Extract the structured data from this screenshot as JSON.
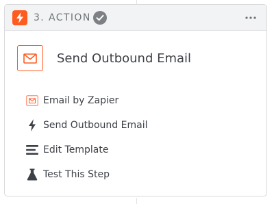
{
  "step": {
    "label": "3. ACTION",
    "status": "complete",
    "more_icon": "more-horizontal-icon",
    "app_icon": "lightning-bolt-icon"
  },
  "title": {
    "text": "Send Outbound Email",
    "icon": "envelope-icon"
  },
  "menu": [
    {
      "label": "Email by Zapier",
      "icon": "envelope-icon"
    },
    {
      "label": "Send Outbound Email",
      "icon": "lightning-bolt-icon"
    },
    {
      "label": "Edit Template",
      "icon": "lines-icon"
    },
    {
      "label": "Test This Step",
      "icon": "flask-icon"
    }
  ],
  "colors": {
    "accent": "#ff5a1f",
    "header_bg": "#f2f3f4",
    "text": "#3d4046",
    "muted": "#6f7378",
    "check": "#7d8186"
  }
}
